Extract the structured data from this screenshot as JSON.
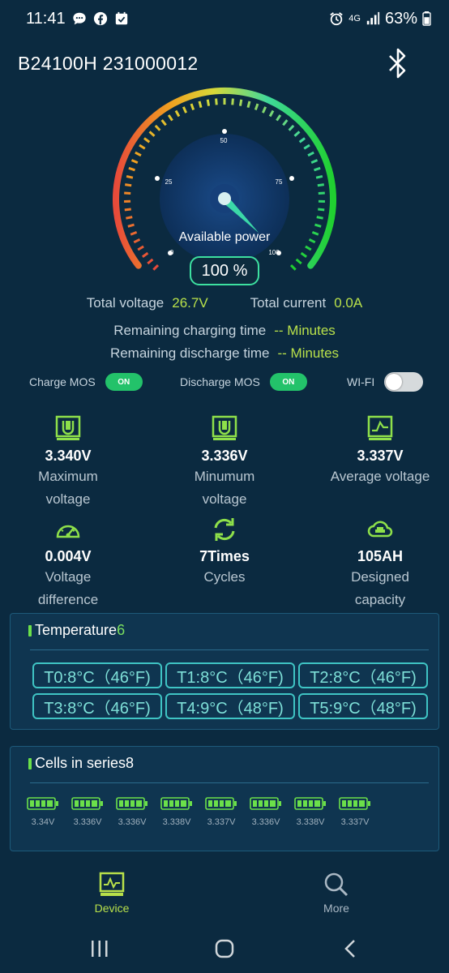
{
  "status_bar": {
    "time": "11:41",
    "network": "4G",
    "battery": "63%"
  },
  "header": {
    "device_name": "B24100H 231000012"
  },
  "gauge": {
    "label": "Available power",
    "percent_text": "100 %",
    "level": 100,
    "ticks": [
      "0",
      "25",
      "50",
      "75",
      "100"
    ]
  },
  "totals": {
    "voltage_label": "Total voltage",
    "voltage_value": "26.7V",
    "current_label": "Total current",
    "current_value": "0.0A"
  },
  "times": {
    "charging_label": "Remaining charging time",
    "charging_value": "-- Minutes",
    "discharge_label": "Remaining discharge time",
    "discharge_value": "-- Minutes"
  },
  "switches": {
    "charge_mos_label": "Charge MOS",
    "charge_mos_state": "ON",
    "discharge_mos_label": "Discharge MOS",
    "discharge_mos_state": "ON",
    "wifi_label": "WI-FI",
    "wifi_on": false
  },
  "stats": [
    {
      "icon": "voltage-meter-icon",
      "value": "3.340V",
      "label_1": "Maximum",
      "label_2": "voltage"
    },
    {
      "icon": "voltage-meter-icon",
      "value": "3.336V",
      "label_1": "Minumum",
      "label_2": "voltage"
    },
    {
      "icon": "voltage-graph-icon",
      "value": "3.337V",
      "label_1": "Average voltage",
      "label_2": ""
    },
    {
      "icon": "speedometer-icon",
      "value": "0.004V",
      "label_1": "Voltage",
      "label_2": "difference"
    },
    {
      "icon": "cycle-icon",
      "value": "7Times",
      "label_1": "Cycles",
      "label_2": ""
    },
    {
      "icon": "cloud-capacity-icon",
      "value": "105AH",
      "label_1": "Designed",
      "label_2": "capacity"
    }
  ],
  "temperature": {
    "title": "Temperature",
    "count": "6",
    "readings": [
      "T0:8°C（46°F)",
      "T1:8°C（46°F)",
      "T2:8°C（46°F)",
      "T3:8°C（46°F)",
      "T4:9°C（48°F)",
      "T5:9°C（48°F)"
    ]
  },
  "cells": {
    "title": "Cells in series",
    "count": "8",
    "voltages": [
      "3.34V",
      "3.336V",
      "3.336V",
      "3.338V",
      "3.337V",
      "3.336V",
      "3.338V",
      "3.337V"
    ]
  },
  "nav": {
    "device_label": "Device",
    "more_label": "More"
  },
  "colors": {
    "background": "#0b2a40",
    "accent_green": "#b8e04a",
    "switch_on": "#23c26a",
    "temp_border": "#3fc4c4",
    "nav_active": "#b8e04a"
  }
}
